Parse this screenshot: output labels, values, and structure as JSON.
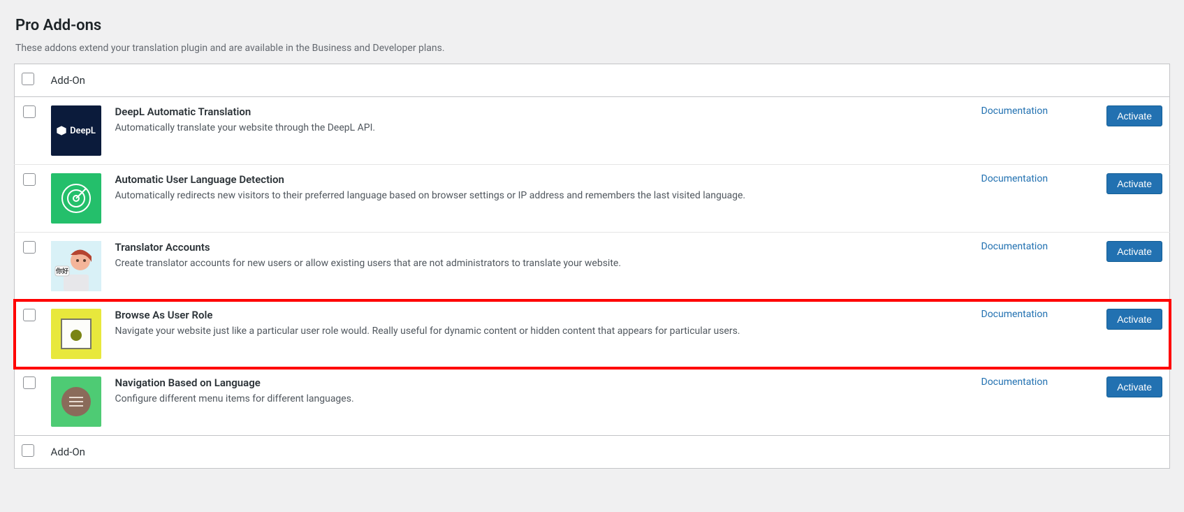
{
  "page": {
    "title": "Pro Add-ons",
    "description": "These addons extend your translation plugin and are available in the Business and Developer plans."
  },
  "table": {
    "header_label": "Add-On",
    "footer_label": "Add-On"
  },
  "labels": {
    "documentation": "Documentation",
    "activate": "Activate"
  },
  "addons": [
    {
      "id": "deepl",
      "title": "DeepL Automatic Translation",
      "description": "Automatically translate your website through the DeepL API.",
      "icon_label": "DeepL",
      "highlighted": false
    },
    {
      "id": "auld",
      "title": "Automatic User Language Detection",
      "description": "Automatically redirects new visitors to their preferred language based on browser settings or IP address and remembers the last visited language.",
      "highlighted": false
    },
    {
      "id": "trans",
      "title": "Translator Accounts",
      "description": "Create translator accounts for new users or allow existing users that are not administrators to translate your website.",
      "highlighted": false
    },
    {
      "id": "browse",
      "title": "Browse As User Role",
      "description": "Navigate your website just like a particular user role would. Really useful for dynamic content or hidden content that appears for particular users.",
      "highlighted": true
    },
    {
      "id": "nav",
      "title": "Navigation Based on Language",
      "description": "Configure different menu items for different languages.",
      "highlighted": false
    }
  ]
}
